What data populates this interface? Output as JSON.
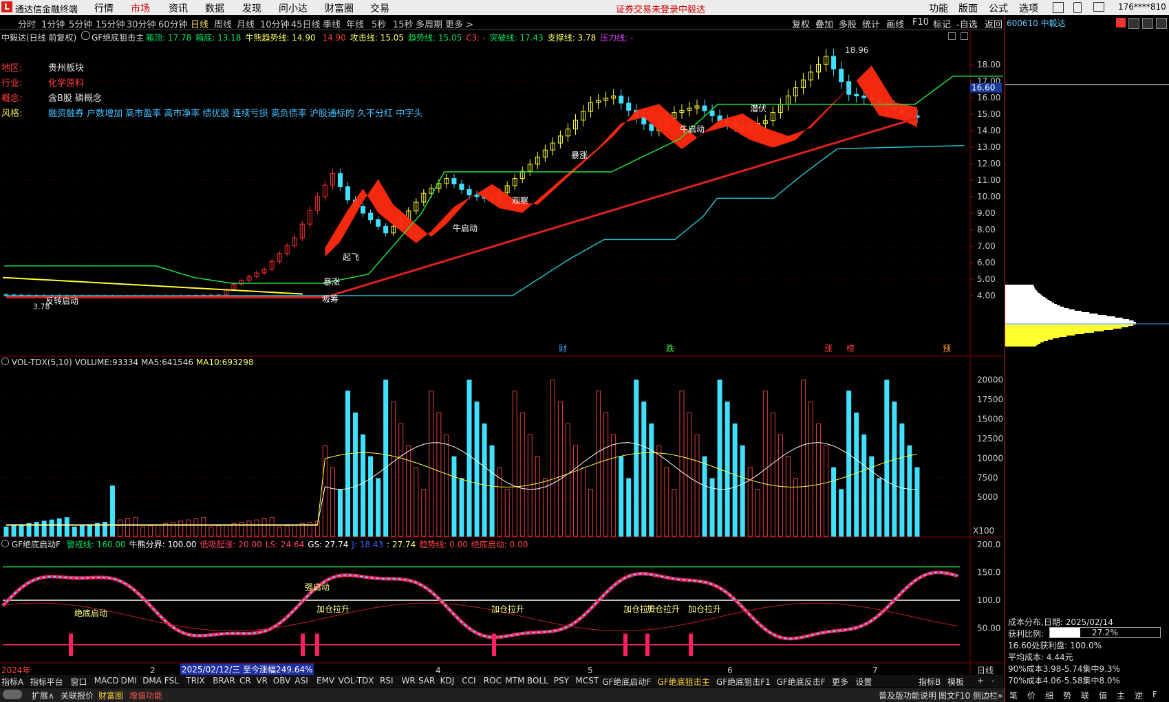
{
  "app": {
    "name": "通达信金融终端",
    "logo_glyph": "L"
  },
  "top_menu": [
    "行情",
    "市场",
    "资讯",
    "数据",
    "发现",
    "问小达",
    "财富圈",
    "交易"
  ],
  "top_menu_active": "市场",
  "top_notice": "证券交易未登录",
  "top_stock_name": "中毅达",
  "top_right_menu": [
    "功能",
    "版面",
    "公式",
    "选项"
  ],
  "account": "176****810",
  "periods": [
    "分时",
    "1分钟",
    "5分钟",
    "15分钟",
    "30分钟",
    "60分钟",
    "日线",
    "周线",
    "月线",
    "10分钟",
    "45日线",
    "季线",
    "年线",
    "5秒",
    "15秒",
    "多周期",
    "更多 >"
  ],
  "period_selected": "日线",
  "toolbar_right": [
    "复权",
    "叠加",
    "多股",
    "统计",
    "画线",
    "F10",
    "标记",
    "-自选",
    "返回"
  ],
  "chart_header": {
    "stock": "中毅达(日线 前复权)",
    "indicator": "GF绝底狙击主",
    "items": [
      {
        "label": "箱顶:",
        "value": "17.78",
        "color": "#00e060"
      },
      {
        "label": "箱底:",
        "value": "13.18",
        "color": "#00e060"
      },
      {
        "label": "牛熊趋势线:",
        "value": "14.90",
        "color": "#ffff66"
      },
      {
        "label": "",
        "value": "14.90",
        "color": "#ff4040"
      },
      {
        "label": "攻击线:",
        "value": "15.05",
        "color": "#ffff66"
      },
      {
        "label": "趋势线:",
        "value": "15.05",
        "color": "#00e060"
      },
      {
        "label": "C3:",
        "value": "-",
        "color": "#ff4040"
      },
      {
        "label": "突破线:",
        "value": "17.43",
        "color": "#00e060"
      },
      {
        "label": "支撑线:",
        "value": "3.78",
        "color": "#ffff66"
      },
      {
        "label": "压力线:",
        "value": "-",
        "color": "#e040ff"
      }
    ]
  },
  "info": {
    "region_label": "地区:",
    "region": "贵州板块",
    "industry_label": "行业:",
    "industry": "化学原料",
    "concept_label": "概念:",
    "concept": "含B股 磷概念",
    "style_label": "风格:",
    "style": "融资融券 户数增加 高市盈率 高市净率 绩优股 连续亏损 高负债率 沪股通标的 久不分红 中字头"
  },
  "price_axis": [
    "18.00",
    "17.00",
    "16.00",
    "15.00",
    "14.00",
    "13.00",
    "12.00",
    "11.00",
    "10.00",
    "9.00",
    "8.00",
    "7.00",
    "6.00",
    "5.00",
    "4.00"
  ],
  "current_price_tag": "16.60",
  "high_label": "18.96",
  "low_label": "3.78",
  "chart_annotations": [
    "反转启动",
    "吸筹",
    "暴涨",
    "起飞",
    "牛启动",
    "观察",
    "暴涨",
    "牛启动",
    "潜伏"
  ],
  "event_markers": [
    "财",
    "跌",
    "涨",
    "榜",
    "预"
  ],
  "volume_header": {
    "name": "VOL-TDX(5,10)",
    "volume_label": "VOLUME:",
    "volume": "93334",
    "ma5_label": "MA5:",
    "ma5": "641546",
    "ma10_label": "MA10:",
    "ma10": "693298"
  },
  "volume_axis": [
    "20000",
    "17500",
    "15000",
    "12500",
    "10000",
    "7500",
    "5000"
  ],
  "volume_unit": "X100",
  "osc_header": {
    "name": "GF绝底启动F",
    "items": [
      {
        "label": "警戒线:",
        "value": "160.00",
        "color": "#00e060"
      },
      {
        "label": "牛熊分界:",
        "value": "100.00",
        "color": "#ffffff"
      },
      {
        "label": "低吸起涨:",
        "value": "20.00",
        "color": "#ff4060"
      },
      {
        "label": "LS:",
        "value": "24.64",
        "color": "#ff4060"
      },
      {
        "label": "GS:",
        "value": "27.74",
        "color": "#ffffff"
      },
      {
        "label": "J:",
        "value": "18.43",
        "color": "#4060ff"
      },
      {
        "label": ":",
        "value": "27.74",
        "color": "#ffff66"
      },
      {
        "label": "趋势线:",
        "value": "0.00",
        "color": "#ff4040"
      },
      {
        "label": "绝底启动:",
        "value": "0.00",
        "color": "#ff4040"
      }
    ]
  },
  "osc_axis": [
    "200.0",
    "150.0",
    "100.0",
    "50.00"
  ],
  "osc_annotations": [
    "绝底启动",
    "加仓拉升",
    "强启动",
    "加仓拉升",
    "加仓拉升",
    "加仓拉升",
    "加仓拉升"
  ],
  "date_axis": {
    "year": "2024年",
    "months": [
      "2",
      "3",
      "4",
      "5",
      "6",
      "7"
    ],
    "cursor_date": "2025/02/12/三",
    "cursor_info": "至今涨幅249.64%",
    "period_label": "日线"
  },
  "chips": {
    "stock_code": "600610 中毅达",
    "date_label": "成本分布,日期:",
    "date": "2025/02/14",
    "profit_label": "获利比例:",
    "profit": "27.2%",
    "profit_ratio": 0.272,
    "line2_label": "16.60处获利盘:",
    "line2": "100.0%",
    "avg_label": "平均成本:",
    "avg": "4.44元",
    "c90_label": "90%成本",
    "c90": "3.98-5.74集中9.3%",
    "c70_label": "70%成本",
    "c70": "4.06-5.58集中8.0%"
  },
  "bottom_tabs": [
    "指标A",
    "指标平台",
    "窗口",
    "MACD",
    "DMI",
    "DMA",
    "FSL",
    "TRIX",
    "BRAR",
    "CR",
    "VR",
    "OBV",
    "ASI",
    "EMV",
    "VOL-TDX",
    "RSI",
    "WR",
    "SAR",
    "KDJ",
    "CCI",
    "ROC",
    "MTM",
    "BOLL",
    "PSY",
    "MCST",
    "GF绝底启动F",
    "GF绝底狙击主",
    "GF绝底狙击F1",
    "GF绝底反击F",
    "更多",
    "设置"
  ],
  "bottom_tab_selected": "GF绝底狙击主",
  "bottom_tabs_right": [
    "指标B",
    "模板",
    "+",
    "-"
  ],
  "status_left": [
    "扩展∧",
    "关联报价",
    "财富圈",
    "增值功能"
  ],
  "status_right": [
    "普及版功能说明",
    "图文F10",
    "侧边栏»"
  ],
  "chip_tabs": [
    "笔",
    "价",
    "细",
    "势",
    "联",
    "值",
    "主",
    "逆",
    "F"
  ]
}
